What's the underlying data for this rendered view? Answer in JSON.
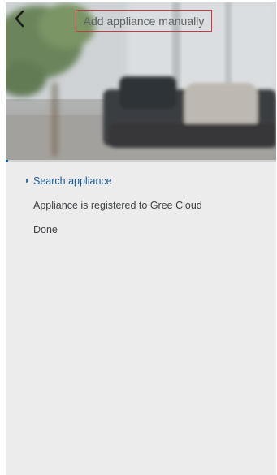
{
  "header": {
    "title": "Add appliance manually",
    "back_icon": "chevron-left-icon"
  },
  "progress": {
    "fraction": 0.01
  },
  "steps": [
    {
      "label": "Search appliance",
      "active": true
    },
    {
      "label": "Appliance is registered to Gree Cloud",
      "active": false
    },
    {
      "label": "Done",
      "active": false
    }
  ],
  "colors": {
    "active_step": "#1d5a92",
    "inactive_step": "#3f4245",
    "title_highlight_border": "#d9343b",
    "screen_background": "#ececec"
  }
}
